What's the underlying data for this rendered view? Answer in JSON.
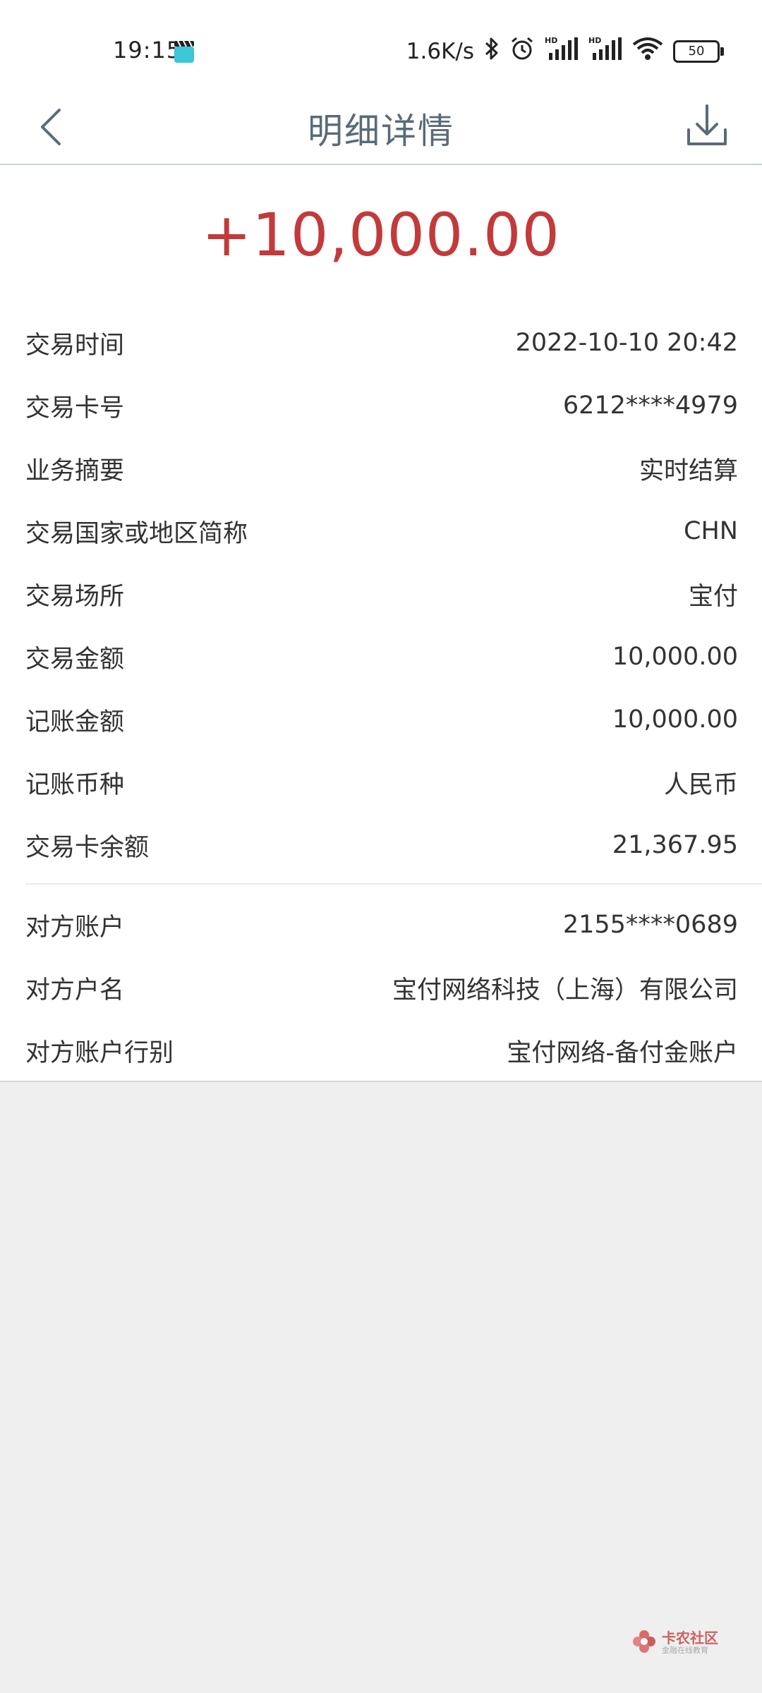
{
  "status_bar": {
    "time": "19:15",
    "speed": "1.6K/s",
    "battery": "50",
    "icons": [
      "clapper-icon",
      "bluetooth-icon",
      "alarm-icon",
      "hd-signal-icon",
      "hd-signal-icon",
      "wifi-icon",
      "battery-icon"
    ]
  },
  "header": {
    "title": "明细详情",
    "back_icon": "chevron-left-icon",
    "download_icon": "download-icon"
  },
  "amount": "+10,000.00",
  "details": [
    {
      "label": "交易时间",
      "value": "2022-10-10 20:42"
    },
    {
      "label": "交易卡号",
      "value": "6212****4979"
    },
    {
      "label": "业务摘要",
      "value": "实时结算"
    },
    {
      "label": "交易国家或地区简称",
      "value": "CHN"
    },
    {
      "label": "交易场所",
      "value": "宝付"
    },
    {
      "label": "交易金额",
      "value": "10,000.00"
    },
    {
      "label": "记账金额",
      "value": "10,000.00"
    },
    {
      "label": "记账币种",
      "value": "人民币"
    },
    {
      "label": "交易卡余额",
      "value": "21,367.95"
    }
  ],
  "counterparty": [
    {
      "label": "对方账户",
      "value": "2155****0689"
    },
    {
      "label": "对方户名",
      "value": "宝付网络科技（上海）有限公司"
    },
    {
      "label": "对方账户行别",
      "value": "宝付网络-备付金账户"
    }
  ],
  "watermark": {
    "title": "卡农社区",
    "subtitle": "金融在线教育"
  },
  "colors": {
    "amount": "#c23a3a",
    "title": "#5a6b78",
    "background": "#efefef"
  }
}
